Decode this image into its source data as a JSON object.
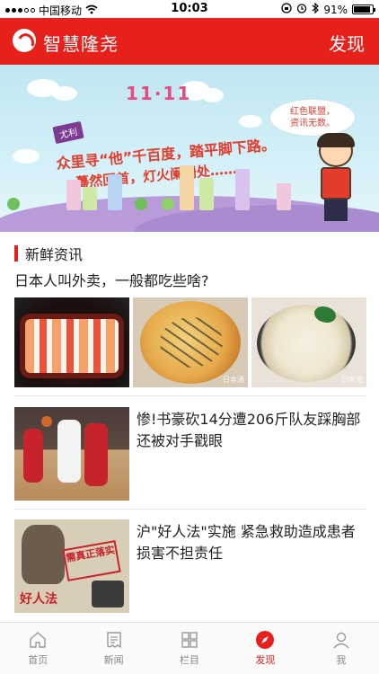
{
  "status_bar": {
    "carrier": "中国移动",
    "time": "10:03",
    "battery": "91%",
    "battery_level": 0.91
  },
  "header": {
    "app_name": "智慧隆尧",
    "right_label": "发现"
  },
  "banner": {
    "number": "11·11",
    "tag": "尤利",
    "line1": "众里寻“他”千百度，踏平脚下路。",
    "line2": "蓦然回首，灯火阑珊处………",
    "bubble_line1": "红色联盟，",
    "bubble_line2": "资讯无数。"
  },
  "section": {
    "title": "新鲜资讯"
  },
  "articles": [
    {
      "title": "日本人叫外卖，一般都吃些啥?",
      "image_icons": [
        "sushi-image",
        "pizza-image",
        "noodle-image"
      ],
      "watermark": "日本通"
    },
    {
      "title": "惨!书豪砍14分遭206斤队友踩胸部还被对手戳眼",
      "image_icon": "basketball-image"
    },
    {
      "title": "沪\"好人法\"实施 紧急救助造成患者损害不担责任",
      "image_icon": "law-image",
      "stamp_text": "需真正落实",
      "label_text": "好人法"
    }
  ],
  "tabbar": {
    "tabs": [
      {
        "label": "首页",
        "icon": "home-icon",
        "active": false
      },
      {
        "label": "新闻",
        "icon": "news-icon",
        "active": false
      },
      {
        "label": "栏目",
        "icon": "grid-icon",
        "active": false
      },
      {
        "label": "发现",
        "icon": "compass-icon",
        "active": true
      },
      {
        "label": "我",
        "icon": "user-icon",
        "active": false
      }
    ]
  },
  "colors": {
    "brand_red": "#e8201b",
    "tab_inactive": "#888888"
  }
}
